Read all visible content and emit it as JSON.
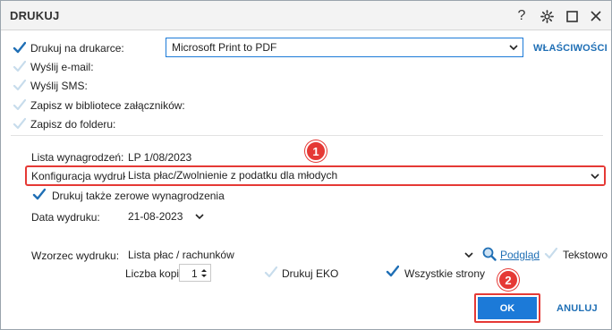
{
  "window": {
    "title": "DRUKUJ"
  },
  "colors": {
    "accent": "#1c7ad8",
    "check": "#1f6fb5",
    "highlight": "#e53935"
  },
  "outputs": [
    {
      "label": "Drukuj na drukarce:",
      "checked": true
    },
    {
      "label": "Wyślij e-mail:",
      "checked": false
    },
    {
      "label": "Wyślij SMS:",
      "checked": false
    },
    {
      "label": "Zapisz w bibliotece załączników:",
      "checked": false
    },
    {
      "label": "Zapisz do folderu:",
      "checked": false
    }
  ],
  "printer": {
    "value": "Microsoft Print to PDF",
    "properties_label": "WŁAŚCIWOŚCI"
  },
  "form": {
    "payroll_label": "Lista wynagrodzeń:",
    "payroll_value": "LP 1/08/2023",
    "config_label": "Konfiguracja wydruku:",
    "config_value": "Lista płac/Zwolnienie z podatku dla młodych",
    "zero_label": "Drukuj także zerowe wynagrodzenia",
    "date_label": "Data wydruku:",
    "date_value": "21-08-2023",
    "template_label": "Wzorzec wydruku:",
    "template_value": "Lista płac / rachunków",
    "preview_label": "Podgląd",
    "text_label": "Tekstowo",
    "copies_label": "Liczba kopii:",
    "copies_value": "1",
    "eko_label": "Drukuj EKO",
    "all_pages_label": "Wszystkie strony"
  },
  "annotations": {
    "badge1": "1",
    "badge2": "2"
  },
  "buttons": {
    "ok": "OK",
    "cancel": "ANULUJ"
  }
}
